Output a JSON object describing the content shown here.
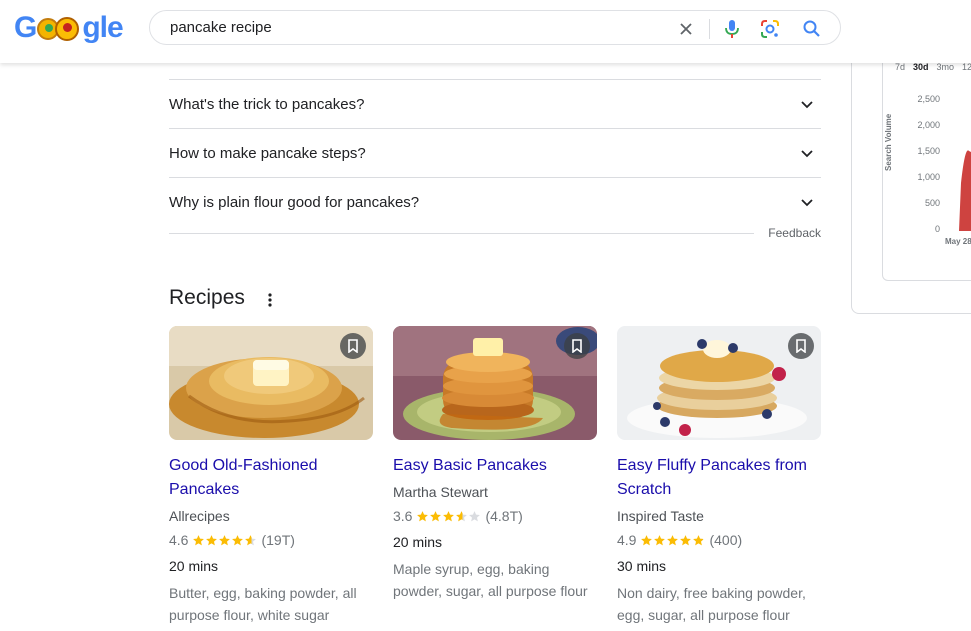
{
  "header": {
    "logo_parts": [
      "G",
      "gle"
    ],
    "search_value": "pancake recipe",
    "clear_label": "×"
  },
  "people_also_ask": [
    {
      "question": "What's the trick to pancakes?"
    },
    {
      "question": "How to make pancake steps?"
    },
    {
      "question": "Why is plain flour good for pancakes?"
    }
  ],
  "feedback_label": "Feedback",
  "recipes": {
    "title": "Recipes",
    "cards": [
      {
        "title": "Good Old-Fashioned Pancakes",
        "source": "Allrecipes",
        "rating": "4.6",
        "stars_value": 4.6,
        "reviews": "(19T)",
        "time": "20 mins",
        "ingredients": "Butter, egg, baking powder, all purpose flour, white sugar"
      },
      {
        "title": "Easy Basic Pancakes",
        "source": "Martha Stewart",
        "rating": "3.6",
        "stars_value": 3.6,
        "reviews": "(4.8T)",
        "time": "20 mins",
        "ingredients": "Maple syrup, egg, baking powder, sugar, all purpose flour"
      },
      {
        "title": "Easy Fluffy Pancakes from Scratch",
        "source": "Inspired Taste",
        "rating": "4.9",
        "stars_value": 4.9,
        "reviews": "(400)",
        "time": "30 mins",
        "ingredients": "Non dairy, free baking powder, egg, sugar, all purpose flour"
      }
    ]
  },
  "trends_panel": {
    "range_tabs": [
      "7d",
      "30d",
      "3mo",
      "12"
    ],
    "active_tab": "30d",
    "ylabel": "Search Volume",
    "yticks": [
      "2,500",
      "2,000",
      "1,500",
      "1,000",
      "500",
      "0"
    ],
    "xtick": "May 28"
  },
  "colors": {
    "link": "#1a0dab",
    "star": "#fbbc04",
    "chart_fill": "#c5221f"
  }
}
